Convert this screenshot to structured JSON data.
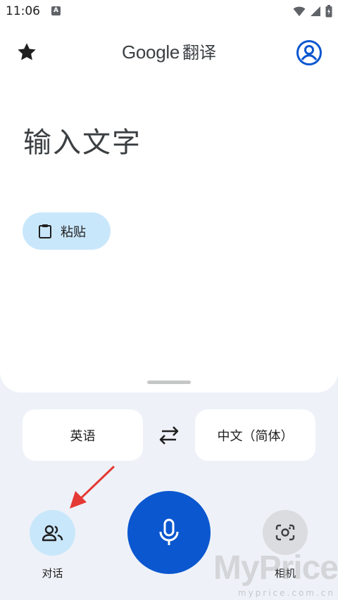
{
  "status_bar": {
    "time": "11:06",
    "indicator": "A"
  },
  "app_bar": {
    "title_brand": "Google",
    "title_suffix": "翻译"
  },
  "input": {
    "placeholder": "输入文字"
  },
  "paste_chip": {
    "label": "粘贴"
  },
  "languages": {
    "source": "英语",
    "target": "中文（简体）"
  },
  "actions": {
    "conversation_label": "对话",
    "camera_label": "相机"
  },
  "watermark": {
    "text": "MyPrice",
    "subtext": "myprice.com.cn"
  },
  "colors": {
    "accent_blue": "#0b57d0",
    "chip_blue": "#c9e7fb",
    "background": "#eef2f8",
    "annotation_red": "#e53935"
  },
  "icons": {
    "favorites": "star-icon",
    "account": "account-circle-icon",
    "paste": "clipboard-icon",
    "swap": "swap-horizontal-icon",
    "conversation": "people-icon",
    "microphone": "mic-icon",
    "camera": "camera-lens-icon"
  }
}
